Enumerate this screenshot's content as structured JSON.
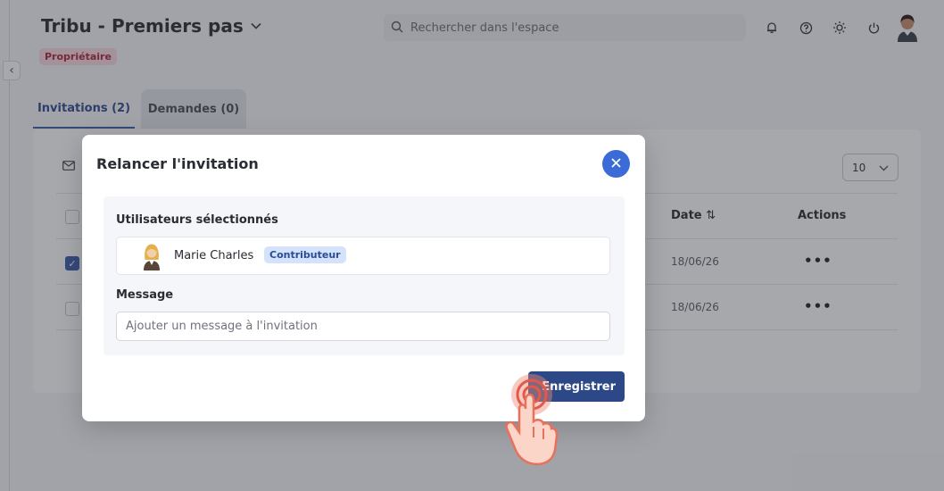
{
  "header": {
    "space_title": "Tribu - Premiers pas",
    "role_badge": "Propriétaire",
    "search_placeholder": "Rechercher dans l'espace",
    "icons": [
      "bell-icon",
      "help-icon",
      "sun-icon",
      "power-icon"
    ]
  },
  "tabs": [
    {
      "label": "Invitations (2)",
      "active": true
    },
    {
      "label": "Demandes (0)",
      "active": false
    }
  ],
  "table": {
    "per_page": "10",
    "columns": [
      "Date",
      "Actions"
    ],
    "rows": [
      {
        "checked": true,
        "date": "18/06/26",
        "actions": "•••"
      },
      {
        "checked": false,
        "date": "18/06/26",
        "actions": "•••"
      }
    ]
  },
  "modal": {
    "title": "Relancer l'invitation",
    "selected_users_label": "Utilisateurs sélectionnés",
    "user": {
      "name": "Marie Charles",
      "role": "Contributeur"
    },
    "message_label": "Message",
    "message_placeholder": "Ajouter un message à l'invitation",
    "message_value": "",
    "save_label": "Enregistrer"
  },
  "colors": {
    "accent": "#3b6bd6",
    "primary_button": "#2c4886",
    "role_badge_bg": "#f9d9e0",
    "role_badge_text": "#b0223b",
    "contributor_badge_bg": "#d4e3fb"
  }
}
